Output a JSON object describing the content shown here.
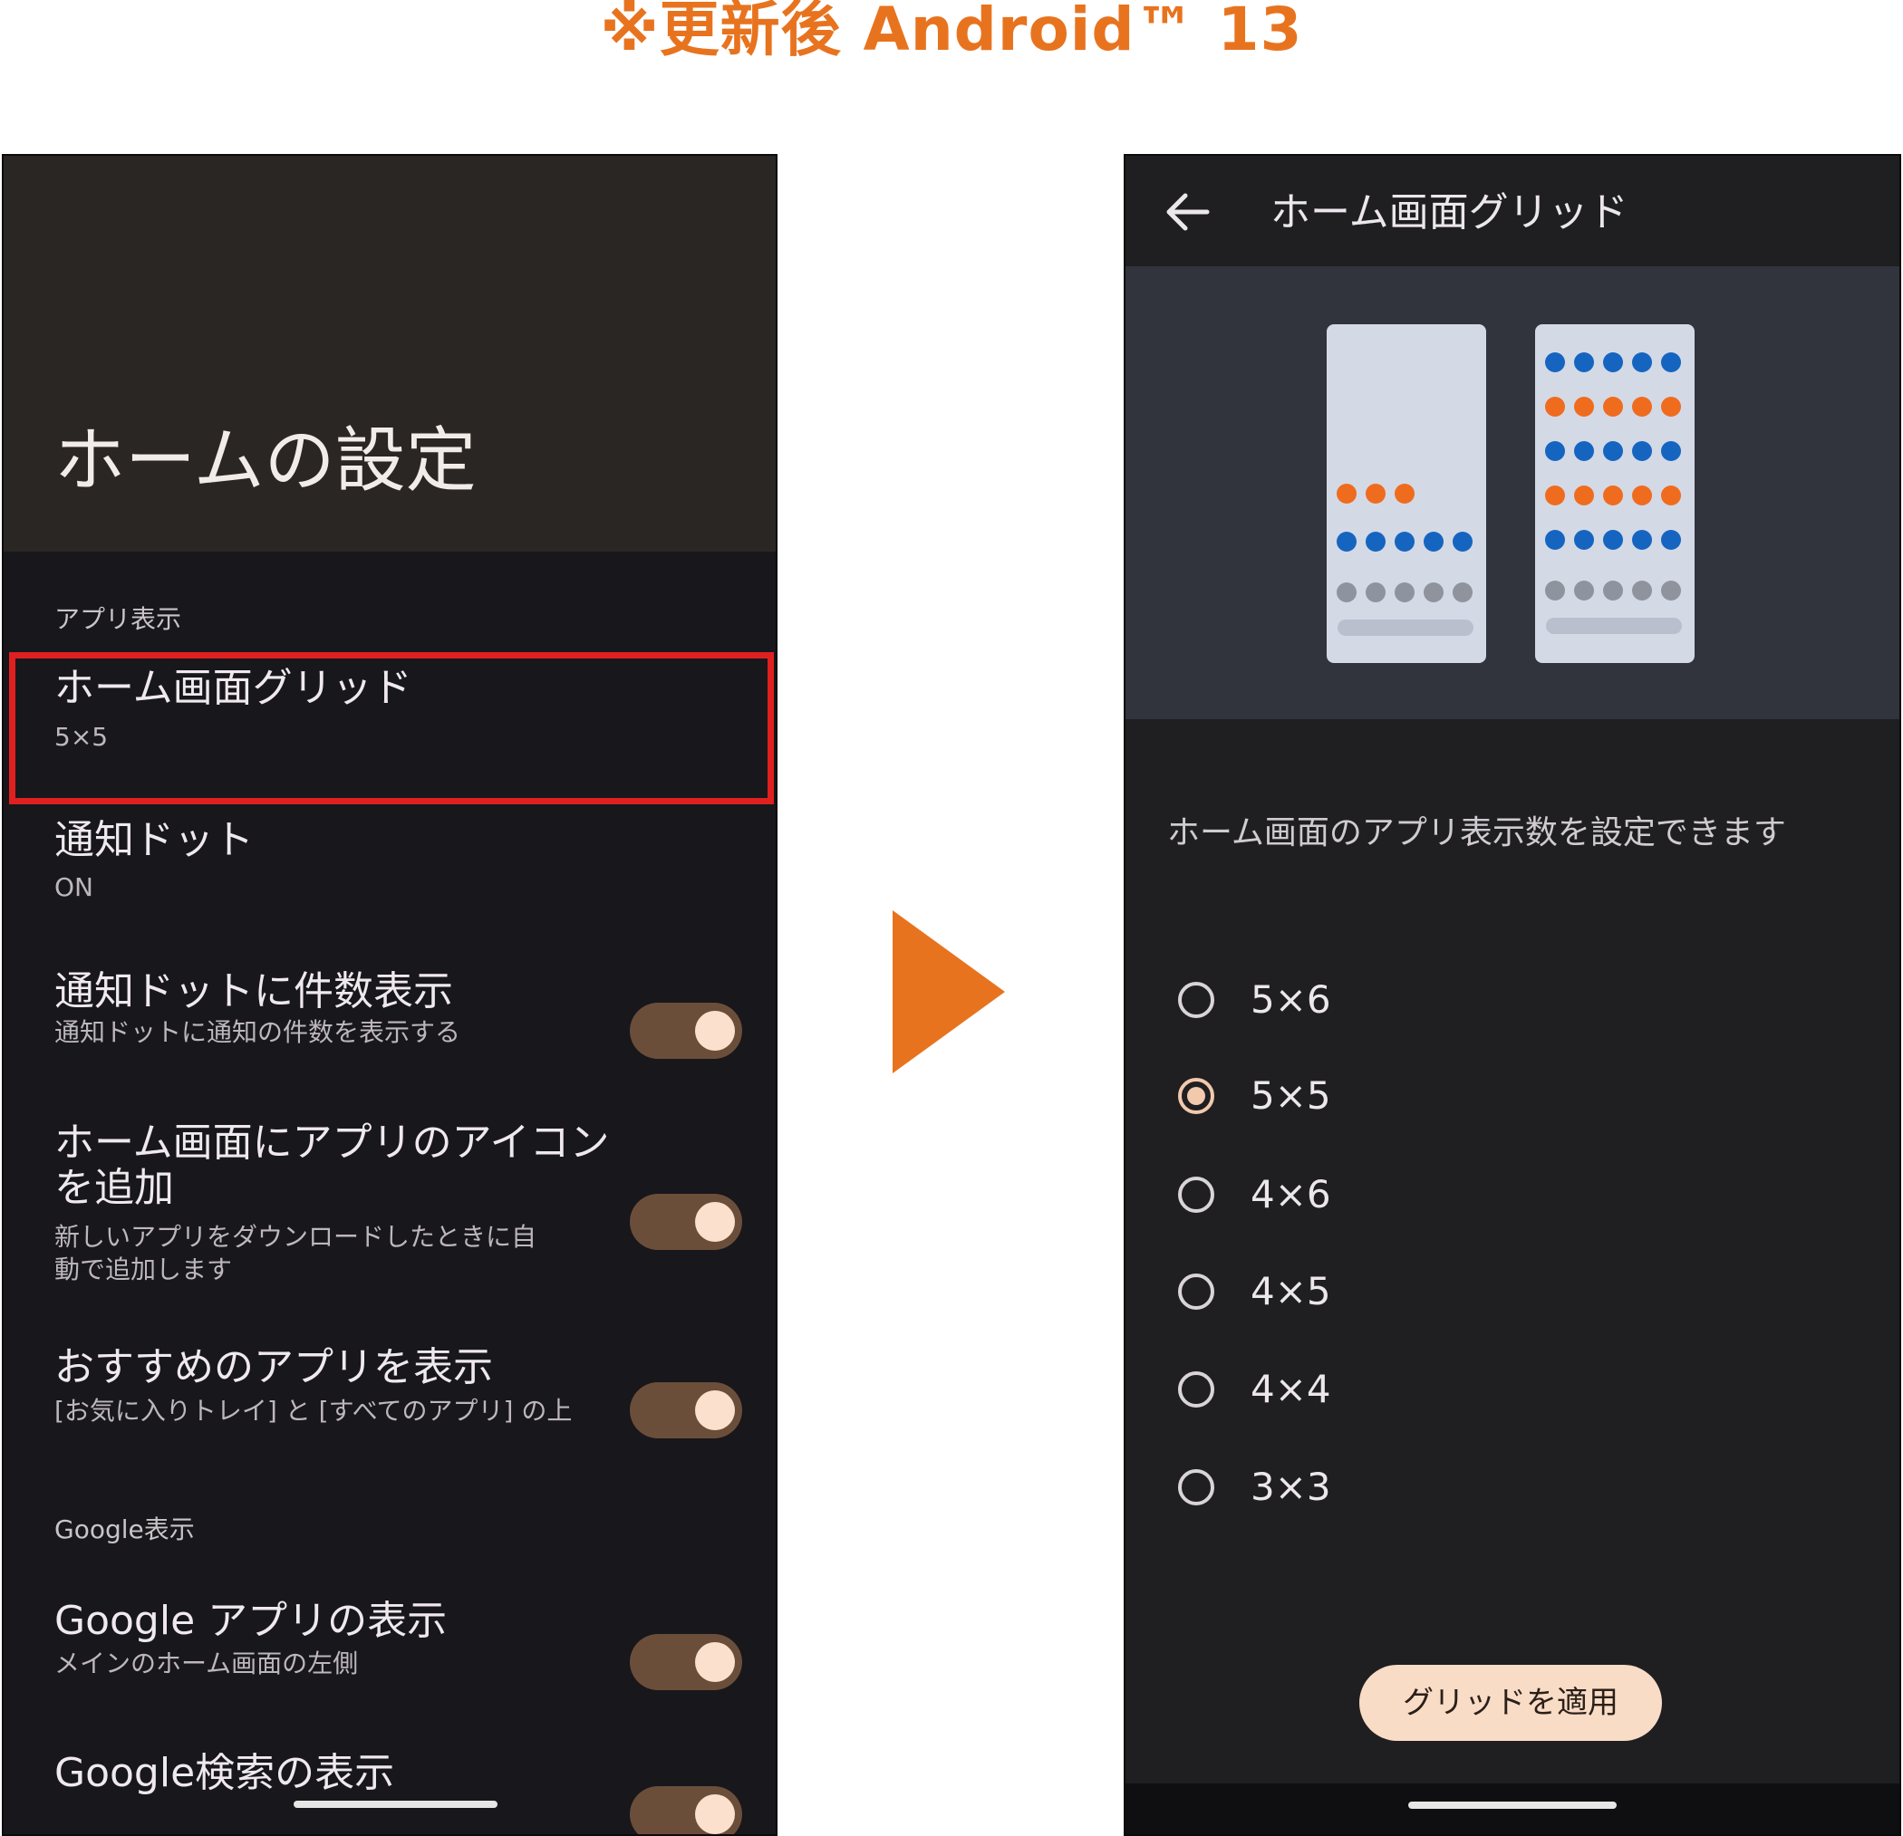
{
  "heading": "※更新後 Android™ 13",
  "left": {
    "title": "ホームの設定",
    "section_app": "アプリ表示",
    "grid_item": {
      "title": "ホーム画面グリッド",
      "value": "5×5"
    },
    "dot_item": {
      "title": "通知ドット",
      "value": "ON"
    },
    "dot_count_item": {
      "title": "通知ドットに件数表示",
      "sub": "通知ドットに通知の件数を表示する",
      "toggle": "on"
    },
    "add_icon_item": {
      "title_line1": "ホーム画面にアプリのアイコン",
      "title_line2": "を追加",
      "sub_line1": "新しいアプリをダウンロードしたときに自",
      "sub_line2": "動で追加します",
      "toggle": "on"
    },
    "suggest_item": {
      "title": "おすすめのアプリを表示",
      "sub": "[お気に入りトレイ] と [すべてのアプリ] の上",
      "toggle": "on"
    },
    "section_google": "Google表示",
    "google_app_item": {
      "title": "Google アプリの表示",
      "sub": "メインのホーム画面の左側",
      "toggle": "on"
    },
    "google_search_item": {
      "title": "Google検索の表示",
      "toggle": "on"
    }
  },
  "right": {
    "title": "ホーム画面グリッド",
    "description": "ホーム画面のアプリ表示数を設定できます",
    "options": [
      "5×6",
      "5×5",
      "4×6",
      "4×5",
      "4×4",
      "3×3"
    ],
    "selected": "5×5",
    "apply_label": "グリッドを適用"
  },
  "colors": {
    "accent_orange": "#e8731f",
    "highlight_red": "#e02020",
    "toggle_track": "#6b4e3a",
    "toggle_knob": "#fbe1cd",
    "dot_blue": "#1565c0",
    "dot_orange": "#ef6c1e",
    "dot_gray": "#8f939e"
  }
}
